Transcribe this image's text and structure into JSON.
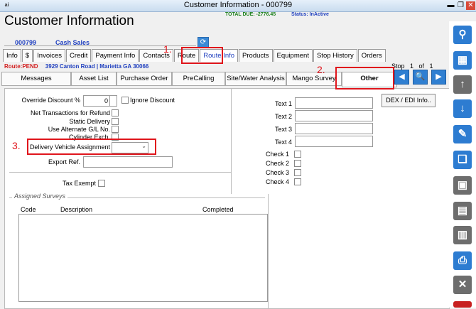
{
  "window": {
    "title": "Customer Information - 000799",
    "app_icon": "ai",
    "controls": {
      "minimize": "▬",
      "restore": "❐",
      "close": "✕"
    }
  },
  "header": {
    "title": "Customer Information",
    "total_due": "TOTAL DUE: -2776.45",
    "status": "Status: InActive",
    "account_number": "000799",
    "account_name": "Cash Sales",
    "refresh_icon": "⟳"
  },
  "tabs_row1": [
    "Info",
    "$",
    "Invoices",
    "Credit",
    "Payment Info",
    "Contacts",
    "Route",
    "Route Info",
    "Products",
    "Equipment",
    "Stop History",
    "Orders"
  ],
  "route_line": {
    "code": "Route:PEND",
    "address": "3929 Canton Road | Marietta GA 30066"
  },
  "stop": "Stop   1   of   1",
  "tabs_row2": [
    "Messages",
    "Asset List",
    "Purchase Order",
    "PreCalling",
    "Site/Water Analysis",
    "Mango Survey",
    "Other"
  ],
  "nav": {
    "back": "◀",
    "search": "🔍",
    "forward": "▶"
  },
  "form": {
    "override_discount_label": "Override Discount %",
    "override_discount_value": "0",
    "ignore_discount_label": "Ignore Discount",
    "net_transactions_label": "Net Transactions for Refund",
    "static_delivery_label": "Static Delivery",
    "use_alt_gl_label": "Use Alternate G/L No.",
    "cylinder_exch_label": "Cylinder Exch.",
    "delivery_vehicle_label": "Delivery Vehicle Assignment",
    "export_ref_label": "Export Ref.",
    "tax_exempt_label": "Tax Exempt",
    "text_labels": [
      "Text 1",
      "Text 2",
      "Text 3",
      "Text 4"
    ],
    "check_labels": [
      "Check 1",
      "Check 2",
      "Check 3",
      "Check 4"
    ],
    "dex_button": "DEX / EDI Info..",
    "assigned_surveys_label": "Assigned Surveys",
    "survey_columns": [
      "Code",
      "Description",
      "Completed"
    ]
  },
  "annotations": [
    "1.",
    "2.",
    "3."
  ],
  "toolbar_icons": [
    "search-icon",
    "grid-icon",
    "up-arrow-icon",
    "down-arrow-icon",
    "edit-icon",
    "copy-icon",
    "add-note-icon",
    "save-icon",
    "delete-icon",
    "print-icon",
    "cancel-icon"
  ],
  "colors": {
    "accent": "#2d7cd1",
    "annotation": "#e0151c",
    "route_code": "#d32020",
    "total_due": "#1a7f1a"
  }
}
